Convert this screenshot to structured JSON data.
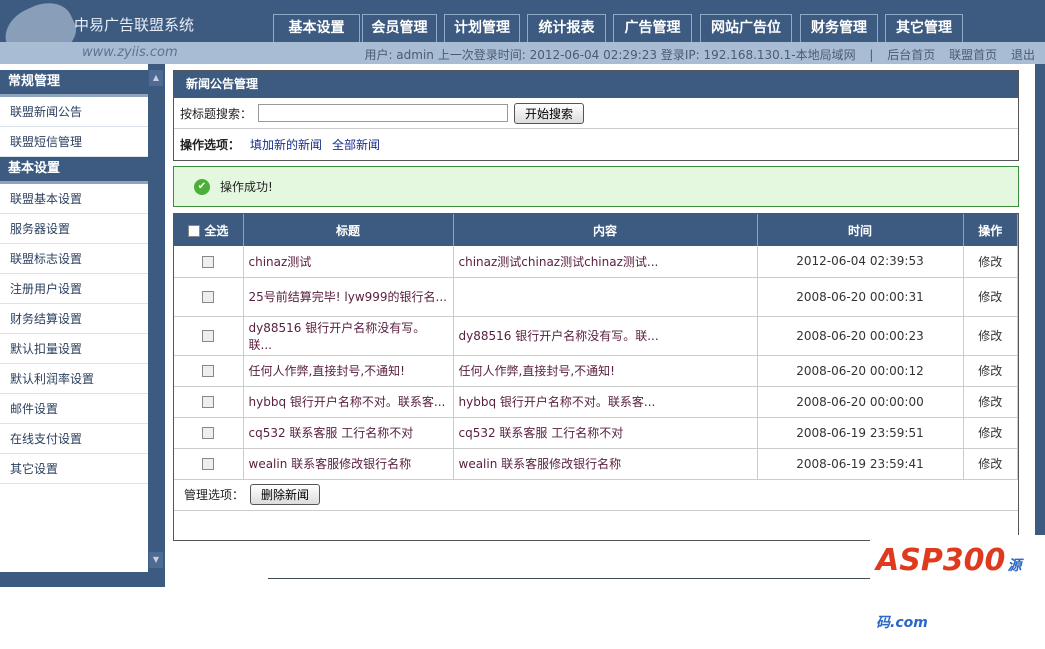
{
  "header": {
    "logo_title": "中易广告联盟系统",
    "logo_url": "www.zyiis.com",
    "tabs": [
      "基本设置",
      "会员管理",
      "计划管理",
      "统计报表",
      "广告管理",
      "网站广告位",
      "财务管理",
      "其它管理"
    ],
    "user_info": "用户: admin 上一次登录时间: 2012-06-04 02:29:23 登录IP: 192.168.130.1-本地局域网",
    "sep": "|",
    "links": [
      "后台首页",
      "联盟首页",
      "退出"
    ]
  },
  "sidebar": {
    "sections": [
      {
        "title": "常规管理",
        "items": [
          "联盟新闻公告",
          "联盟短信管理"
        ]
      },
      {
        "title": "基本设置",
        "items": [
          "联盟基本设置",
          "服务器设置",
          "联盟标志设置",
          "注册用户设置",
          "财务结算设置",
          "默认扣量设置",
          "默认利润率设置",
          "邮件设置",
          "在线支付设置",
          "其它设置"
        ]
      }
    ]
  },
  "panel": {
    "title": "新闻公告管理",
    "search_label": "按标题搜索：",
    "search_value": "",
    "search_button": "开始搜索",
    "options_label": "操作选项：",
    "option_links": [
      "填加新的新闻",
      "全部新闻"
    ]
  },
  "message": "操作成功!",
  "table": {
    "headers": [
      "全选",
      "标题",
      "内容",
      "时间",
      "操作"
    ],
    "rows": [
      {
        "title": "chinaz测试",
        "content": "chinaz测试chinaz测试chinaz测试...",
        "time": "2012-06-04 02:39:53",
        "action": "修改"
      },
      {
        "title": "25号前结算完毕! lyw999的银行名...",
        "content": "",
        "time": "2008-06-20 00:00:31",
        "action": "修改"
      },
      {
        "title": "dy88516 银行开户名称没有写。联...",
        "content": "dy88516 银行开户名称没有写。联...",
        "time": "2008-06-20 00:00:23",
        "action": "修改"
      },
      {
        "title": "任何人作弊,直接封号,不通知!",
        "content": "任何人作弊,直接封号,不通知!",
        "time": "2008-06-20 00:00:12",
        "action": "修改"
      },
      {
        "title": "hybbq 银行开户名称不对。联系客...",
        "content": "hybbq 银行开户名称不对。联系客...",
        "time": "2008-06-20 00:00:00",
        "action": "修改"
      },
      {
        "title": "cq532 联系客服 工行名称不对",
        "content": "cq532 联系客服 工行名称不对",
        "time": "2008-06-19 23:59:51",
        "action": "修改"
      },
      {
        "title": "wealin 联系客服修改银行名称",
        "content": "wealin 联系客服修改银行名称",
        "time": "2008-06-19 23:59:41",
        "action": "修改"
      }
    ],
    "manage_label": "管理选项：",
    "delete_button": "删除新闻"
  },
  "watermark": {
    "text": "ASP300",
    "sub": "源码.com"
  }
}
